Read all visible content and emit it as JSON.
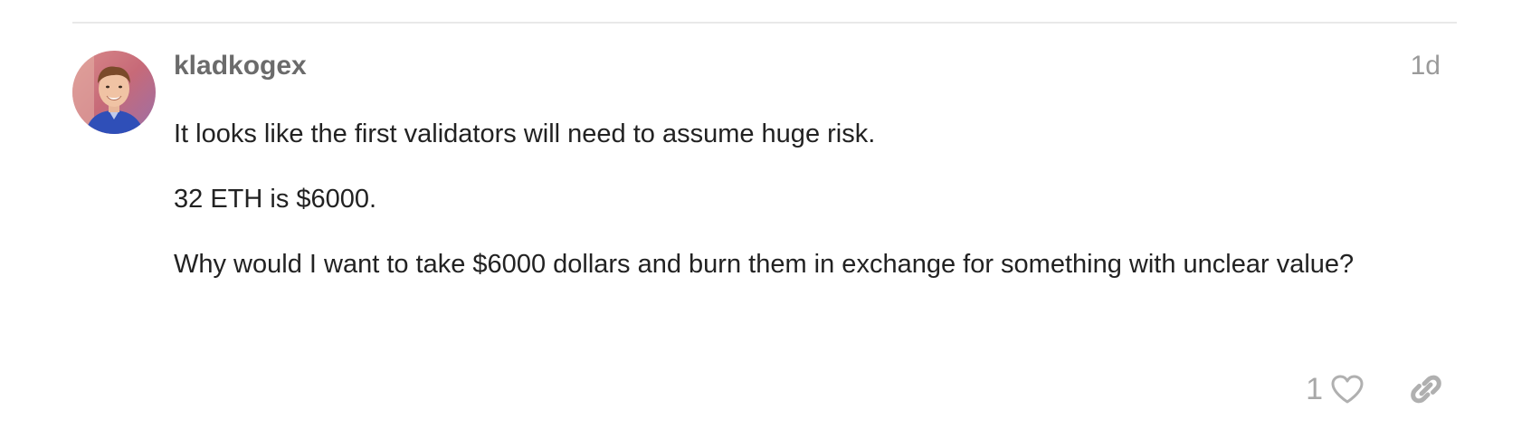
{
  "post": {
    "username": "kladkogex",
    "date": "1d",
    "paragraphs": [
      "It looks like the first validators will need to assume huge risk.",
      "32 ETH is $6000.",
      "Why would I want to take $6000 dollars and burn them in exchange for something with unclear value?"
    ],
    "like_count": "1"
  },
  "icons": {
    "like": "heart-outline-icon",
    "share": "link-icon"
  },
  "colors": {
    "username": "#6b6b6b",
    "meta": "#9a9a9a",
    "icon": "#b0b0b0",
    "text": "#222222",
    "divider": "#e9e9e9"
  }
}
